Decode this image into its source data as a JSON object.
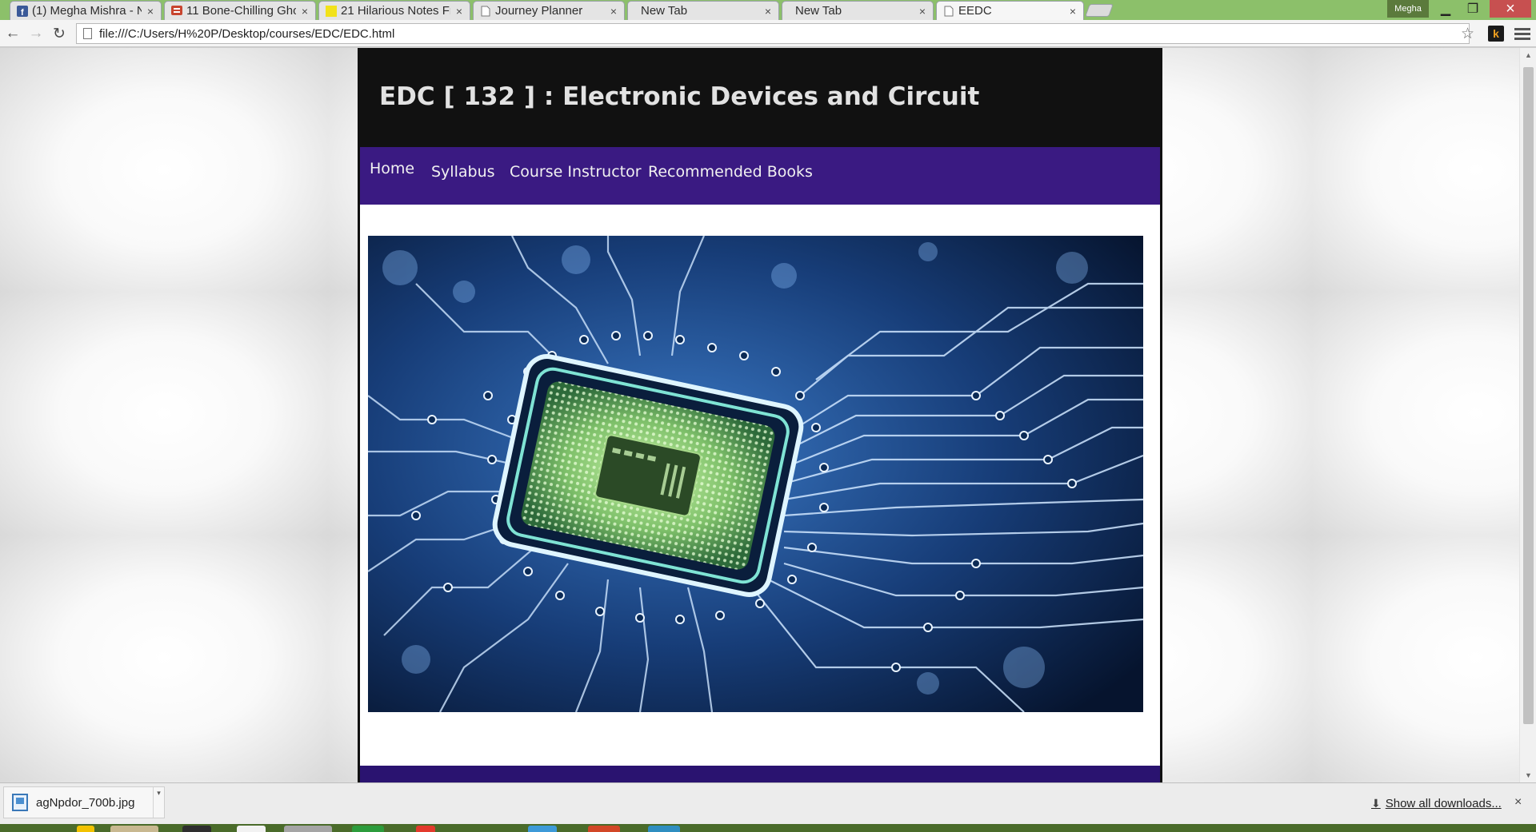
{
  "browser": {
    "tabs": [
      {
        "title": "(1) Megha Mishra - N",
        "favicon": "facebook-icon",
        "active": false
      },
      {
        "title": "11 Bone-Chilling Gho",
        "favicon": "buzzfeed-icon",
        "active": false
      },
      {
        "title": "21 Hilarious Notes Fr",
        "favicon": "yellow-square-icon",
        "active": false
      },
      {
        "title": "Journey Planner",
        "favicon": "page-icon",
        "active": false
      },
      {
        "title": "New Tab",
        "favicon": "",
        "active": false
      },
      {
        "title": "New Tab",
        "favicon": "",
        "active": false
      },
      {
        "title": "EEDC",
        "favicon": "page-icon",
        "active": true
      }
    ],
    "profile_name": "Megha",
    "url": "file:///C:/Users/H%20P/Desktop/courses/EDC/EDC.html",
    "accent_color": "#8cc06a"
  },
  "page": {
    "site_title": "EDC [ 132 ] : Electronic Devices and Circuit",
    "nav": [
      "Home",
      "Syllabus",
      "Course Instructor",
      "Recommended Books"
    ],
    "hero_image": "circuit-board-microchip-image",
    "colors": {
      "header": "#111111",
      "nav": "#3a1a82",
      "footer": "#2a1370"
    }
  },
  "downloads": {
    "items": [
      {
        "filename": "agNpdor_700b.jpg"
      }
    ],
    "show_all_label": "Show all downloads...",
    "close_symbol": "×"
  }
}
